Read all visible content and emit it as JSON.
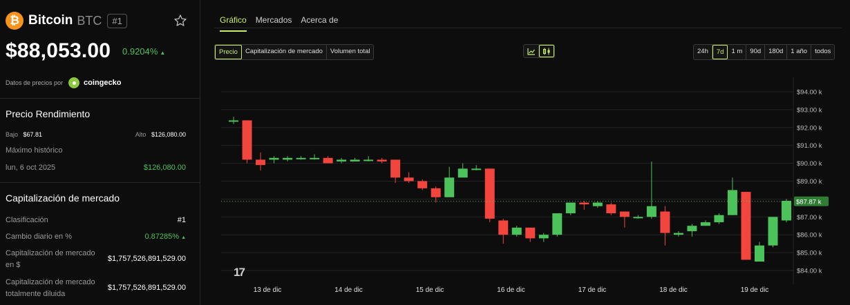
{
  "coin": {
    "logo_glyph": "₿",
    "name": "Bitcoin",
    "symbol": "BTC",
    "rank": "#1",
    "price": "$88,053.00",
    "change": "0.9204%",
    "change_arrow": "▲"
  },
  "provider": {
    "label": "Datos de precios por",
    "name": "coingecko"
  },
  "performance": {
    "title": "Precio Rendimiento",
    "low_label": "Bajo",
    "low_value": "$67.81",
    "high_label": "Alto",
    "high_value": "$126,080.00",
    "ath_label": "Máximo histórico",
    "ath_date": "lun, 6 oct 2025",
    "ath_value": "$126,080.00"
  },
  "market_cap": {
    "title": "Capitalización de mercado",
    "rank_label": "Clasificación",
    "rank_value": "#1",
    "daily_change_label": "Cambio diario en %",
    "daily_change_value": "0.87285%",
    "daily_change_arrow": "▲",
    "cap_label": "Capitalización de mercado en $",
    "cap_value": "$1,757,526,891,529.00",
    "diluted_label": "Capitalización de mercado totalmente diluida",
    "diluted_value": "$1,757,526,891,529.00"
  },
  "tabs": [
    "Gráfico",
    "Mercados",
    "Acerca de"
  ],
  "metric_buttons": [
    "Precio",
    "Capitalización de mercado",
    "Volumen total"
  ],
  "range_buttons": [
    "24h",
    "7d",
    "1 m",
    "90d",
    "180d",
    "1 año",
    "todos"
  ],
  "selected": {
    "tab": "Gráfico",
    "metric": "Precio",
    "range": "7d",
    "chart_style": "candles"
  },
  "chart_icons": [
    "line-chart-icon",
    "candlestick-icon"
  ],
  "colors": {
    "accent": "#c9f06b",
    "up": "#4cc25a",
    "down": "#f2453d",
    "bitcoin": "#f7931a",
    "current_price_label": "#2e7d32"
  },
  "chart_data": {
    "type": "candlestick",
    "y_unit": "USD (miles)",
    "yticks": [
      "$94.00 k",
      "$93.00 k",
      "$92.00 k",
      "$91.00 k",
      "$90.00 k",
      "$89.00 k",
      "$88.00 k",
      "$87.00 k",
      "$86.00 k",
      "$85.00 k",
      "$84.00 k"
    ],
    "ytick_values": [
      94,
      93,
      92,
      91,
      90,
      89,
      88,
      87,
      86,
      85,
      84
    ],
    "xticks": [
      "13 de dic",
      "14 de dic",
      "15 de dic",
      "16 de dic",
      "17 de dic",
      "18 de dic",
      "19 de dic"
    ],
    "current_price_label": "$87.87 k",
    "current_price": 87.87,
    "candles": [
      [
        92.4,
        92.4,
        92.6,
        92.2
      ],
      [
        92.4,
        90.2,
        92.4,
        90.0
      ],
      [
        90.2,
        89.9,
        90.6,
        89.6
      ],
      [
        90.2,
        90.3,
        90.4,
        90.0
      ],
      [
        90.2,
        90.3,
        90.4,
        90.1
      ],
      [
        90.3,
        90.3,
        90.4,
        90.2
      ],
      [
        90.3,
        90.3,
        90.5,
        90.2
      ],
      [
        90.3,
        90.0,
        90.4,
        90.0
      ],
      [
        90.1,
        90.2,
        90.3,
        90.0
      ],
      [
        90.1,
        90.2,
        90.3,
        90.1
      ],
      [
        90.2,
        90.2,
        90.4,
        90.1
      ],
      [
        90.2,
        90.1,
        90.3,
        90.0
      ],
      [
        90.2,
        89.2,
        90.2,
        88.9
      ],
      [
        89.2,
        89.0,
        89.5,
        88.9
      ],
      [
        89.0,
        88.6,
        89.1,
        88.5
      ],
      [
        88.6,
        88.1,
        88.7,
        87.8
      ],
      [
        88.1,
        89.2,
        89.8,
        88.1
      ],
      [
        89.2,
        89.7,
        90.0,
        89.2
      ],
      [
        89.7,
        89.7,
        89.9,
        89.6
      ],
      [
        89.7,
        86.9,
        89.7,
        86.7
      ],
      [
        86.8,
        86.0,
        86.9,
        85.5
      ],
      [
        86.0,
        86.4,
        86.5,
        85.9
      ],
      [
        86.4,
        85.8,
        86.4,
        85.6
      ],
      [
        85.8,
        86.0,
        86.1,
        85.6
      ],
      [
        86.0,
        87.2,
        87.2,
        85.9
      ],
      [
        87.2,
        87.8,
        87.8,
        87.1
      ],
      [
        87.8,
        87.7,
        87.9,
        87.4
      ],
      [
        87.6,
        87.8,
        87.9,
        87.5
      ],
      [
        87.7,
        87.2,
        87.8,
        87.1
      ],
      [
        87.3,
        87.0,
        87.3,
        86.4
      ],
      [
        87.0,
        87.0,
        87.1,
        86.9
      ],
      [
        87.0,
        87.6,
        90.1,
        86.9
      ],
      [
        87.3,
        86.1,
        87.6,
        85.4
      ],
      [
        86.0,
        86.1,
        86.2,
        85.9
      ],
      [
        86.2,
        86.5,
        86.6,
        85.9
      ],
      [
        86.5,
        86.7,
        86.8,
        86.5
      ],
      [
        86.7,
        87.1,
        87.2,
        86.6
      ],
      [
        87.1,
        88.5,
        89.2,
        87.1
      ],
      [
        88.4,
        84.6,
        88.4,
        84.6
      ],
      [
        84.5,
        85.4,
        85.6,
        84.5
      ],
      [
        85.4,
        87.0,
        87.0,
        85.3
      ],
      [
        86.8,
        87.9,
        88.0,
        86.7
      ]
    ]
  }
}
